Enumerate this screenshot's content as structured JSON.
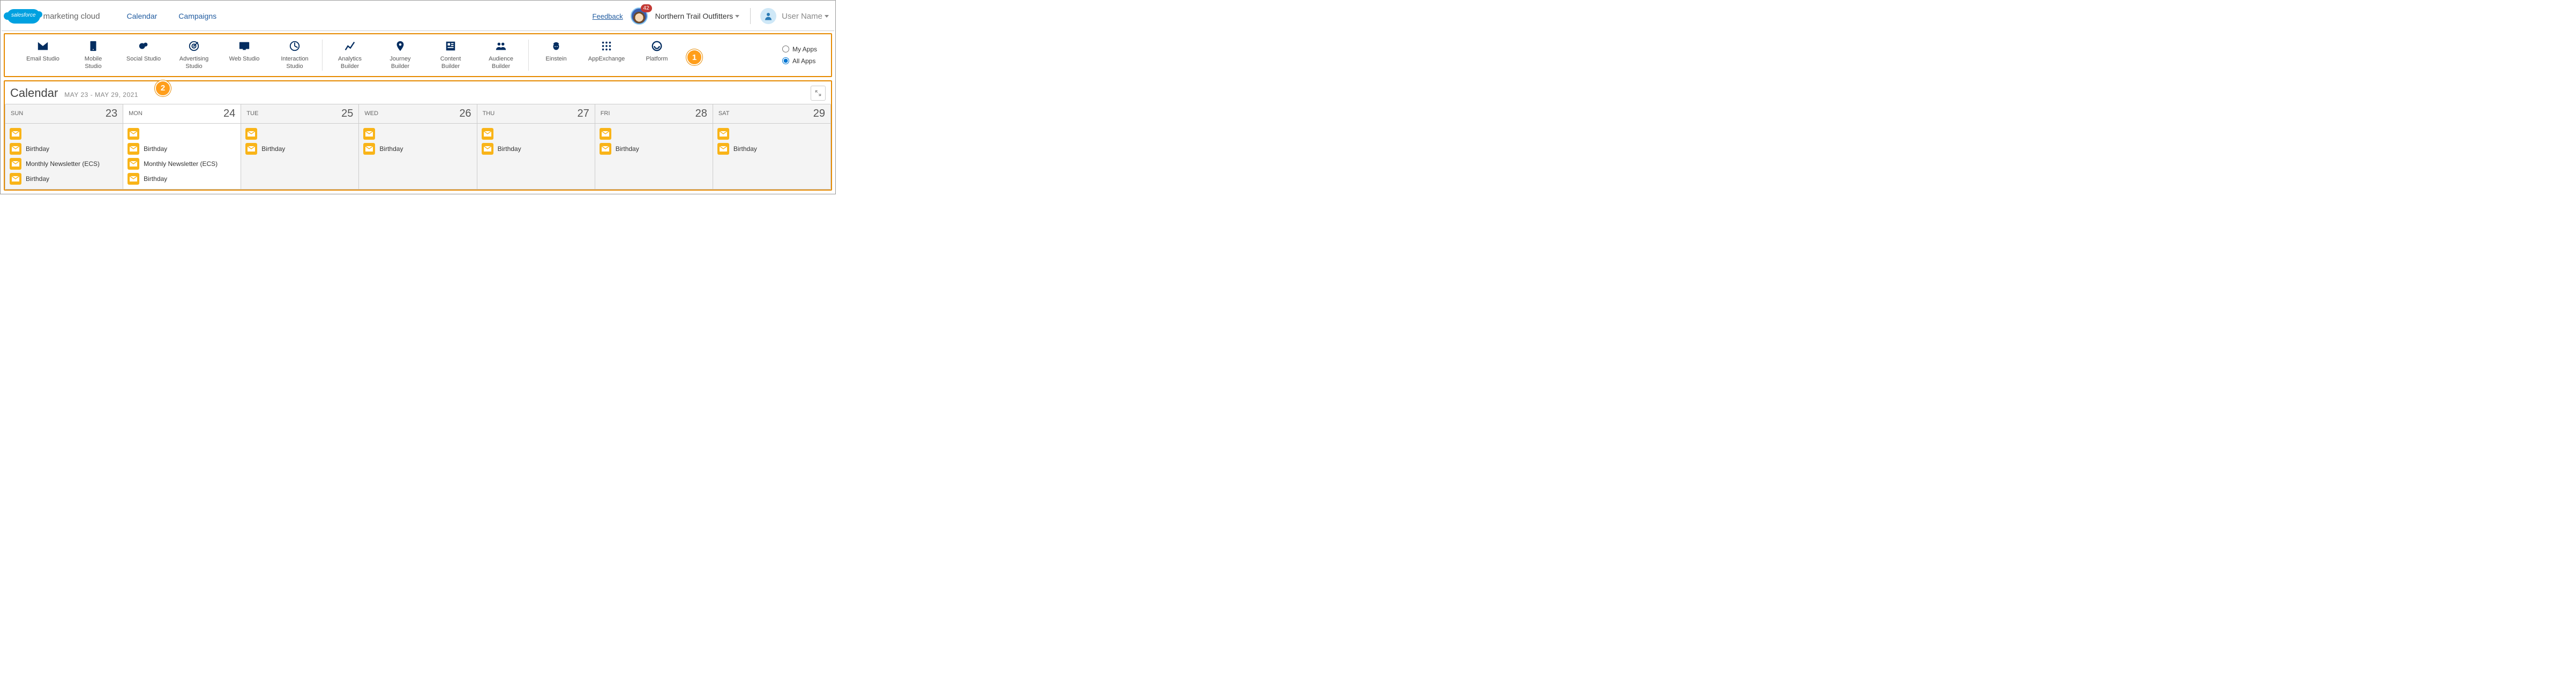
{
  "header": {
    "product_brand": "salesforce",
    "product_name": "marketing cloud",
    "nav": [
      "Calendar",
      "Campaigns"
    ],
    "feedback": "Feedback",
    "notification_count": "42",
    "org_name": "Northern Trail Outfitters",
    "user_name": "User Name"
  },
  "apps": {
    "groups": [
      [
        {
          "label": "Email Studio",
          "icon": "email"
        },
        {
          "label": "Mobile Studio",
          "icon": "mobile"
        },
        {
          "label": "Social Studio",
          "icon": "social"
        },
        {
          "label": "Advertising Studio",
          "icon": "advertising"
        },
        {
          "label": "Web Studio",
          "icon": "web"
        },
        {
          "label": "Interaction Studio",
          "icon": "interaction"
        }
      ],
      [
        {
          "label": "Analytics Builder",
          "icon": "analytics"
        },
        {
          "label": "Journey Builder",
          "icon": "journey"
        },
        {
          "label": "Content Builder",
          "icon": "content"
        },
        {
          "label": "Audience Builder",
          "icon": "audience"
        }
      ],
      [
        {
          "label": "Einstein",
          "icon": "einstein"
        },
        {
          "label": "AppExchange",
          "icon": "appexchange"
        },
        {
          "label": "Platform",
          "icon": "platform"
        }
      ]
    ],
    "filter_options": [
      "My Apps",
      "All Apps"
    ],
    "filter_selected": "All Apps",
    "callouts": {
      "1": "1",
      "2": "2"
    }
  },
  "calendar": {
    "title": "Calendar",
    "range": "MAY 23 - MAY 29, 2021",
    "days": [
      {
        "dow": "SUN",
        "num": "23",
        "today": false,
        "events": [
          {
            "label": ""
          },
          {
            "label": "Birthday"
          },
          {
            "label": "Monthly Newsletter (ECS)"
          },
          {
            "label": "Birthday"
          }
        ]
      },
      {
        "dow": "MON",
        "num": "24",
        "today": true,
        "events": [
          {
            "label": ""
          },
          {
            "label": "Birthday"
          },
          {
            "label": "Monthly Newsletter (ECS)"
          },
          {
            "label": "Birthday"
          }
        ]
      },
      {
        "dow": "TUE",
        "num": "25",
        "today": false,
        "events": [
          {
            "label": ""
          },
          {
            "label": "Birthday"
          }
        ]
      },
      {
        "dow": "WED",
        "num": "26",
        "today": false,
        "events": [
          {
            "label": ""
          },
          {
            "label": "Birthday"
          }
        ]
      },
      {
        "dow": "THU",
        "num": "27",
        "today": false,
        "events": [
          {
            "label": ""
          },
          {
            "label": "Birthday"
          }
        ]
      },
      {
        "dow": "FRI",
        "num": "28",
        "today": false,
        "events": [
          {
            "label": ""
          },
          {
            "label": "Birthday"
          }
        ]
      },
      {
        "dow": "SAT",
        "num": "29",
        "today": false,
        "events": [
          {
            "label": ""
          },
          {
            "label": "Birthday"
          }
        ]
      }
    ]
  }
}
